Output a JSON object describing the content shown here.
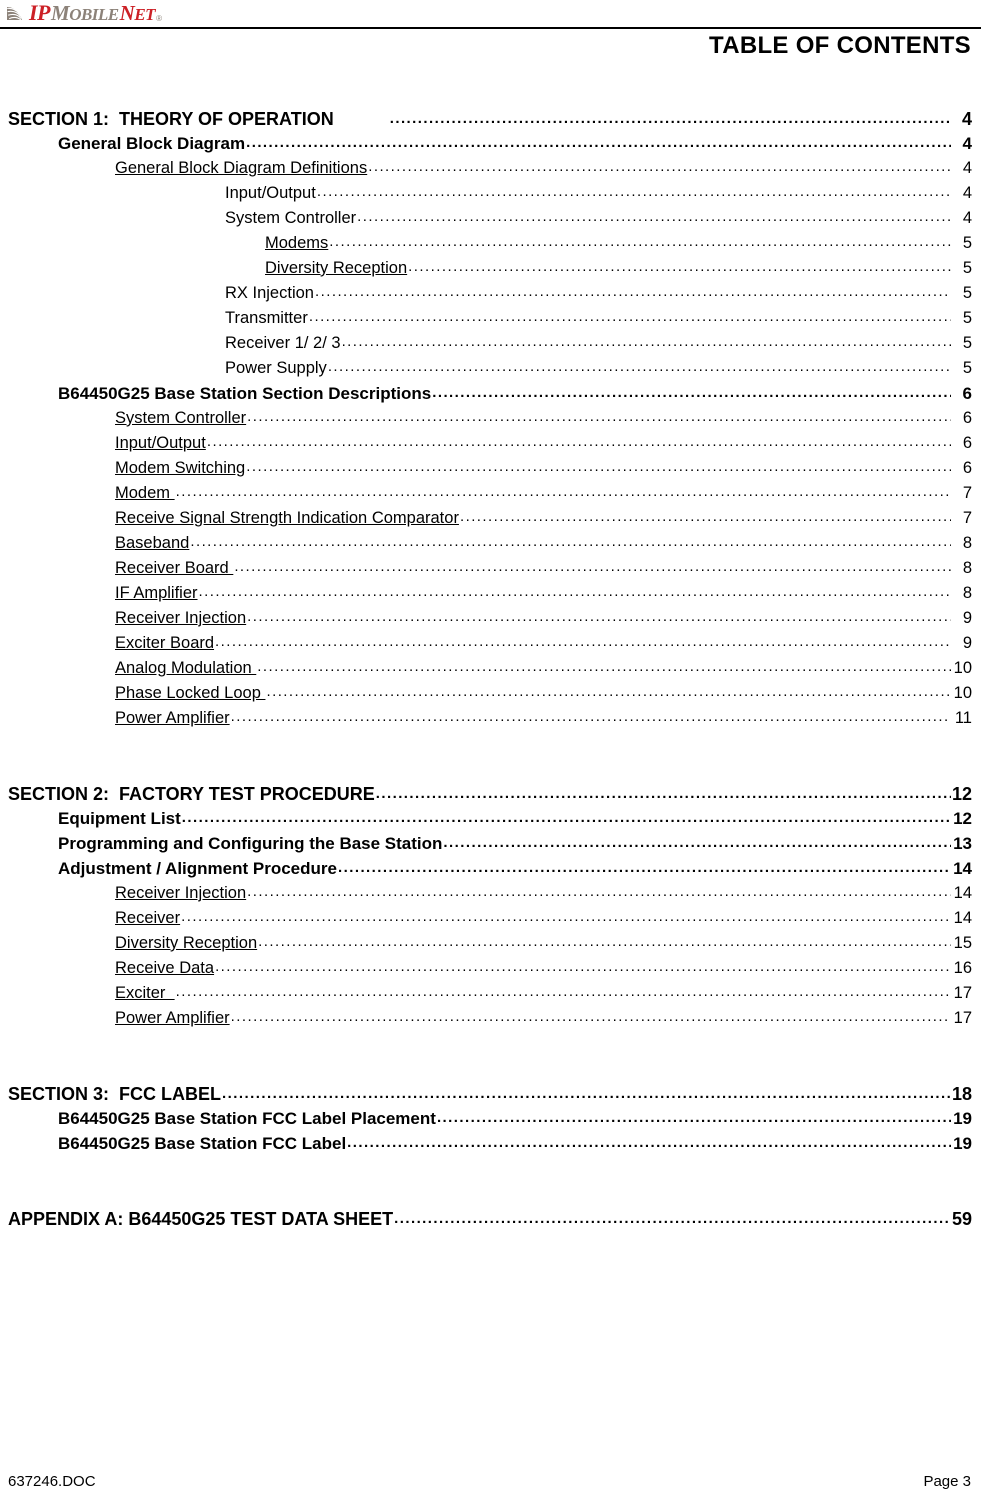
{
  "header": {
    "logo": {
      "icon": "signal-wave-icon",
      "part1": "IP",
      "part2_cap": "M",
      "part2_rest": "OBILE",
      "part3_cap": "N",
      "part3_rest": "ET",
      "trademark": "®",
      "color_red": "#CC2026",
      "color_gray": "#8C8279"
    },
    "title": "TABLE OF CONTENTS"
  },
  "toc": {
    "entries": [
      {
        "label": "SECTION 1:  THEORY OF OPERATION",
        "page": "4",
        "level": 0,
        "underline": false,
        "tab_gap": true
      },
      {
        "label": "General Block Diagram",
        "page": "4",
        "level": 1,
        "underline": false,
        "tab_gap": false
      },
      {
        "label": "General Block Diagram Definitions",
        "page": "4",
        "level": 2,
        "underline": true,
        "tab_gap": false
      },
      {
        "label": "Input/Output",
        "page": "4",
        "level": 3,
        "underline": false,
        "tab_gap": false
      },
      {
        "label": "System Controller",
        "page": "4",
        "level": 3,
        "underline": false,
        "tab_gap": false
      },
      {
        "label": "Modems",
        "page": "5",
        "level": 4,
        "underline": true,
        "tab_gap": false
      },
      {
        "label": "Diversity Reception",
        "page": "5",
        "level": 4,
        "underline": true,
        "tab_gap": false
      },
      {
        "label": "RX Injection",
        "page": "5",
        "level": 3,
        "underline": false,
        "tab_gap": false
      },
      {
        "label": "Transmitter",
        "page": "5",
        "level": 3,
        "underline": false,
        "tab_gap": false
      },
      {
        "label": "Receiver 1/ 2/ 3",
        "page": "5",
        "level": 3,
        "underline": false,
        "tab_gap": false
      },
      {
        "label": "Power Supply",
        "page": "5",
        "level": 3,
        "underline": false,
        "tab_gap": false
      },
      {
        "label": "B64450G25 Base Station Section Descriptions",
        "page": "6",
        "level": 1,
        "underline": false,
        "tab_gap": false
      },
      {
        "label": "System Controller",
        "page": "6",
        "level": 2,
        "underline": true,
        "tab_gap": false
      },
      {
        "label": "Input/Output",
        "page": "6",
        "level": 2,
        "underline": true,
        "tab_gap": false
      },
      {
        "label": "Modem Switching",
        "page": "6",
        "level": 2,
        "underline": true,
        "tab_gap": false
      },
      {
        "label": "Modem ",
        "page": "7",
        "level": 2,
        "underline": true,
        "tab_gap": false
      },
      {
        "label": "Receive Signal Strength Indication Comparator",
        "page": "7",
        "level": 2,
        "underline": true,
        "tab_gap": false
      },
      {
        "label": "Baseband",
        "page": "8",
        "level": 2,
        "underline": true,
        "tab_gap": false
      },
      {
        "label": "Receiver Board ",
        "page": "8",
        "level": 2,
        "underline": true,
        "tab_gap": false
      },
      {
        "label": "IF Amplifier",
        "page": "8",
        "level": 2,
        "underline": true,
        "tab_gap": false
      },
      {
        "label": "Receiver Injection",
        "page": "9",
        "level": 2,
        "underline": true,
        "tab_gap": false
      },
      {
        "label": "Exciter Board",
        "page": "9",
        "level": 2,
        "underline": true,
        "tab_gap": false
      },
      {
        "label": "Analog Modulation ",
        "page": "10",
        "level": 2,
        "underline": true,
        "tab_gap": false
      },
      {
        "label": "Phase Locked Loop ",
        "page": "10",
        "level": 2,
        "underline": true,
        "tab_gap": false
      },
      {
        "label": "Power Amplifier",
        "page": "11",
        "level": 2,
        "underline": true,
        "tab_gap": false
      },
      {
        "spacer": 2
      },
      {
        "label": "SECTION 2:  FACTORY TEST PROCEDURE",
        "page": "12",
        "level": 0,
        "underline": false,
        "tab_gap": false
      },
      {
        "label": "Equipment List",
        "page": "12",
        "level": 1,
        "underline": false,
        "tab_gap": false
      },
      {
        "label": "Programming and Configuring the Base Station",
        "page": "13",
        "level": 1,
        "underline": false,
        "tab_gap": false
      },
      {
        "label": "Adjustment / Alignment Procedure",
        "page": "14",
        "level": 1,
        "underline": false,
        "tab_gap": false
      },
      {
        "label": "Receiver Injection",
        "page": "14",
        "level": 2,
        "underline": true,
        "tab_gap": false
      },
      {
        "label": "Receiver",
        "page": "14",
        "level": 2,
        "underline": true,
        "tab_gap": false
      },
      {
        "label": "Diversity Reception",
        "page": "15",
        "level": 2,
        "underline": true,
        "tab_gap": false
      },
      {
        "label": "Receive Data",
        "page": "16",
        "level": 2,
        "underline": true,
        "tab_gap": false
      },
      {
        "label": "Exciter  ",
        "page": "17",
        "level": 2,
        "underline": true,
        "tab_gap": false
      },
      {
        "label": "Power Amplifier",
        "page": "17",
        "level": 2,
        "underline": true,
        "tab_gap": false
      },
      {
        "spacer": 2
      },
      {
        "label": "SECTION 3:  FCC LABEL",
        "page": "18",
        "level": 0,
        "underline": false,
        "tab_gap": false
      },
      {
        "label": "B64450G25 Base Station FCC Label Placement",
        "page": "19",
        "level": 1,
        "underline": false,
        "tab_gap": false
      },
      {
        "label": "B64450G25 Base Station FCC Label",
        "page": "19",
        "level": 1,
        "underline": false,
        "tab_gap": false
      },
      {
        "spacer": 2
      },
      {
        "label": "APPENDIX A: B64450G25 TEST DATA SHEET",
        "page": "59",
        "level": 0,
        "underline": false,
        "tab_gap": false
      }
    ]
  },
  "footer": {
    "document_name": "637246.DOC",
    "page_label": "Page 3"
  }
}
